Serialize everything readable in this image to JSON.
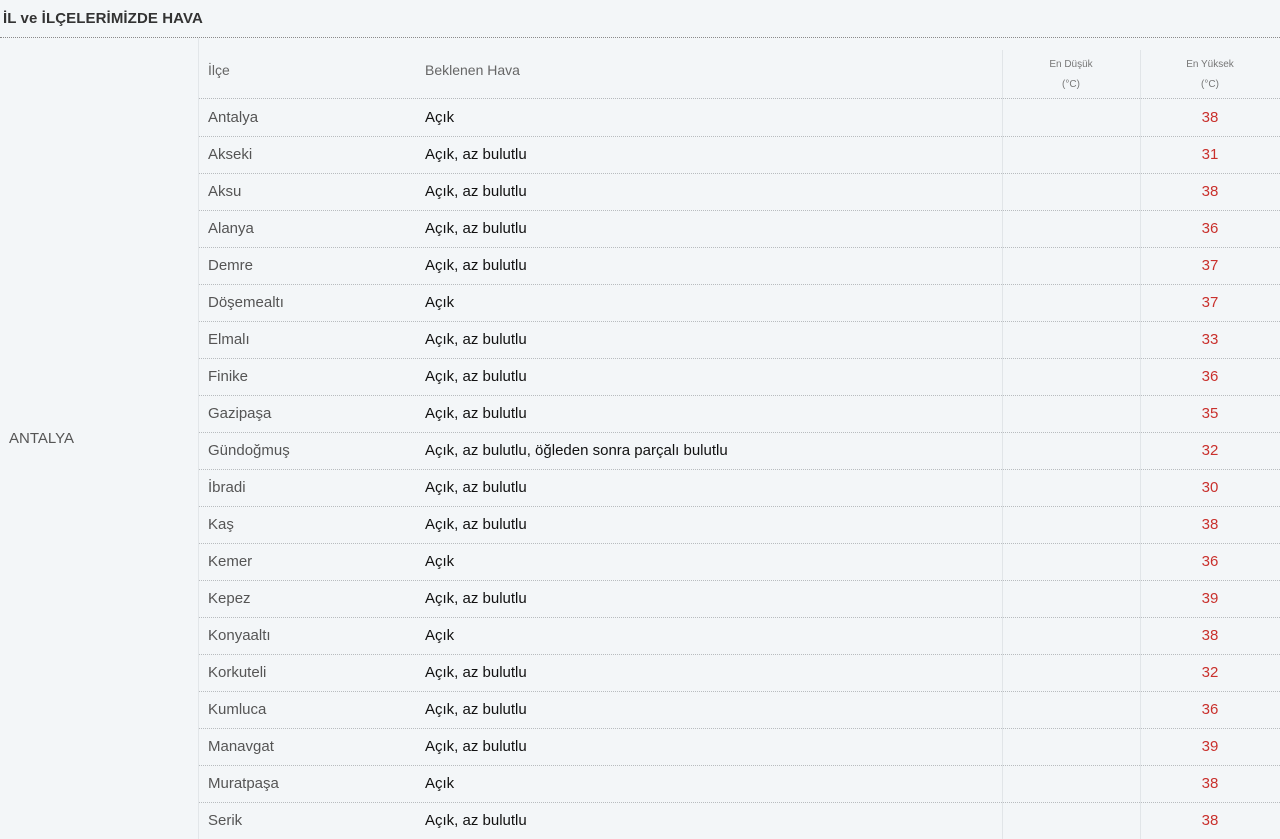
{
  "section_title": "İL ve İLÇELERİMİZDE HAVA",
  "province": "ANTALYA",
  "table": {
    "headers": {
      "ilce": "İlçe",
      "hava": "Beklenen Hava",
      "min_line1": "En Düşük",
      "min_line2": "(°C)",
      "max_line1": "En Yüksek",
      "max_line2": "(°C)"
    },
    "rows": [
      {
        "ilce": "Antalya",
        "hava": "Açık",
        "max": "38"
      },
      {
        "ilce": "Akseki",
        "hava": "Açık, az bulutlu",
        "max": "31"
      },
      {
        "ilce": "Aksu",
        "hava": "Açık, az bulutlu",
        "max": "38"
      },
      {
        "ilce": "Alanya",
        "hava": "Açık, az bulutlu",
        "max": "36"
      },
      {
        "ilce": "Demre",
        "hava": "Açık, az bulutlu",
        "max": "37"
      },
      {
        "ilce": "Döşemealtı",
        "hava": "Açık",
        "max": "37"
      },
      {
        "ilce": "Elmalı",
        "hava": "Açık, az bulutlu",
        "max": "33"
      },
      {
        "ilce": "Finike",
        "hava": "Açık, az bulutlu",
        "max": "36"
      },
      {
        "ilce": "Gazipaşa",
        "hava": "Açık, az bulutlu",
        "max": "35"
      },
      {
        "ilce": "Gündoğmuş",
        "hava": "Açık, az bulutlu, öğleden sonra parçalı bulutlu",
        "max": "32"
      },
      {
        "ilce": "İbradi",
        "hava": "Açık, az bulutlu",
        "max": "30"
      },
      {
        "ilce": "Kaş",
        "hava": "Açık, az bulutlu",
        "max": "38"
      },
      {
        "ilce": "Kemer",
        "hava": "Açık",
        "max": "36"
      },
      {
        "ilce": "Kepez",
        "hava": "Açık, az bulutlu",
        "max": "39"
      },
      {
        "ilce": "Konyaaltı",
        "hava": "Açık",
        "max": "38"
      },
      {
        "ilce": "Korkuteli",
        "hava": "Açık, az bulutlu",
        "max": "32"
      },
      {
        "ilce": "Kumluca",
        "hava": "Açık, az bulutlu",
        "max": "36"
      },
      {
        "ilce": "Manavgat",
        "hava": "Açık, az bulutlu",
        "max": "39"
      },
      {
        "ilce": "Muratpaşa",
        "hava": "Açık",
        "max": "38"
      },
      {
        "ilce": "Serik",
        "hava": "Açık, az bulutlu",
        "max": "38"
      }
    ]
  },
  "colors": {
    "background": "#f3f6f8",
    "max_temp": "#c9302c"
  }
}
